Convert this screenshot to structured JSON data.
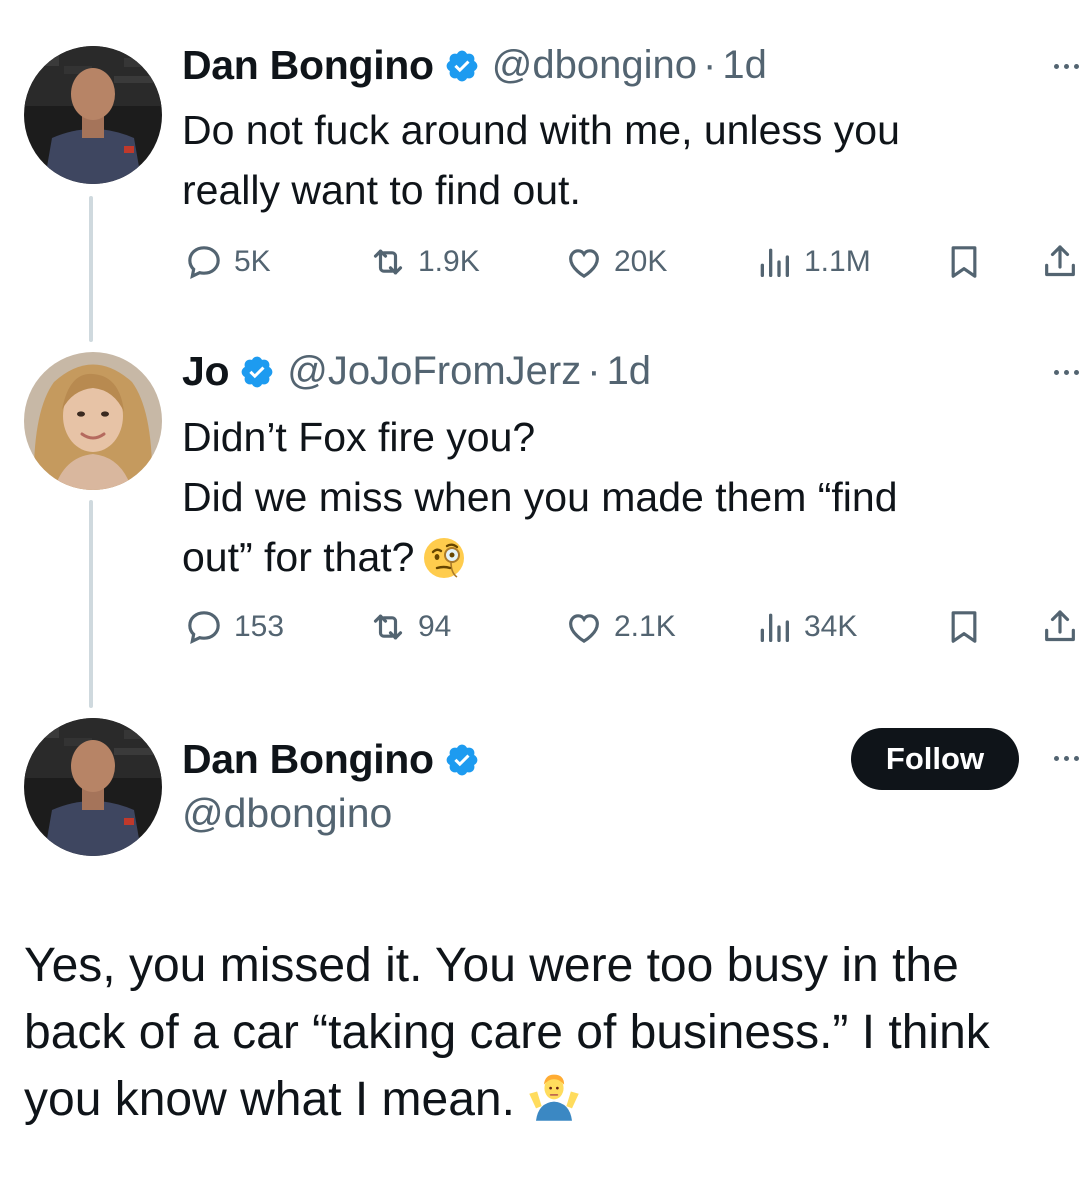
{
  "tweets": [
    {
      "name": "Dan Bongino",
      "handle": "@dbongino",
      "sep": "·",
      "time": "1d",
      "lines": [
        "Do not fuck around with me, unless you",
        "really want to find out."
      ],
      "stats": {
        "replies": "5K",
        "reposts": "1.9K",
        "likes": "20K",
        "views": "1.1M"
      }
    },
    {
      "name": "Jo",
      "handle": "@JoJoFromJerz",
      "sep": "·",
      "time": "1d",
      "lines": [
        "Didn’t Fox fire you?",
        "Did we miss when you made them “find",
        "out” for that?"
      ],
      "emoji": "face-with-monocle",
      "stats": {
        "replies": "153",
        "reposts": "94",
        "likes": "2.1K",
        "views": "34K"
      }
    }
  ],
  "main_tweet": {
    "name": "Dan Bongino",
    "handle": "@dbongino",
    "follow_label": "Follow",
    "lines": [
      "Yes, you missed it. You were too busy in the",
      "back of a car “taking care of business.” I think",
      "you know what I mean."
    ],
    "emoji": "man-shrugging"
  },
  "colors": {
    "text": "#0f1419",
    "secondary": "#536471",
    "verified": "#1d9bf0",
    "thread_line": "#cfd9de"
  }
}
